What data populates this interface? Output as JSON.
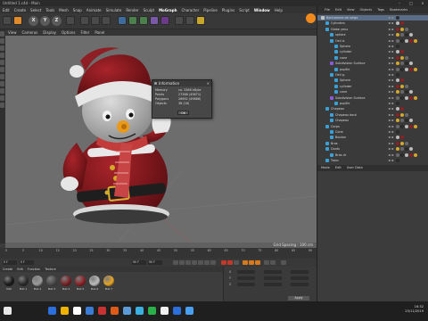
{
  "window": {
    "title": "Untitled 1.c4d - Main",
    "ctrl_min": "–",
    "ctrl_max": "□",
    "ctrl_close": "×"
  },
  "menu": [
    "Edit",
    "Create",
    "Select",
    "Tools",
    "Mesh",
    "Snap",
    "Animate",
    "Simulate",
    "Render",
    "Sculpt",
    "MoGraph",
    "Character",
    "Pipeline",
    "Plugins",
    "Script",
    "Window",
    "Help"
  ],
  "toolbar": {
    "axis_labels": [
      "X",
      "Y",
      "Z"
    ]
  },
  "viewport": {
    "menu": [
      "View",
      "Cameras",
      "Display",
      "Options",
      "Filter",
      "Panel"
    ],
    "grid_spacing": "Grid Spacing : 100 cm"
  },
  "info_dialog": {
    "title": "Information",
    "rows": [
      {
        "label": "Memory",
        "value": "ca. 3366 kByte"
      },
      {
        "label": "Points",
        "value": "27568 (49871)"
      },
      {
        "label": "Polygons",
        "value": "26692 (49886)"
      },
      {
        "label": "Objects",
        "value": "38 (16)"
      }
    ],
    "ok_label": "OK"
  },
  "timeline": {
    "ticks": [
      "0",
      "5",
      "10",
      "15",
      "20",
      "25",
      "30",
      "35",
      "40",
      "45",
      "50",
      "55",
      "60",
      "65",
      "70",
      "75",
      "80",
      "85",
      "90"
    ],
    "frame_start": "0 F",
    "frame_end": "90 F",
    "current": "0 F"
  },
  "material_tabs": [
    "Create",
    "Edit",
    "Function",
    "Texture"
  ],
  "materials": [
    {
      "name": "Mat",
      "color": "#1a1a1a"
    },
    {
      "name": "Mat.1",
      "color": "#2a2a2a"
    },
    {
      "name": "Mat.2",
      "color": "#9a9a9a"
    },
    {
      "name": "Mat.3",
      "color": "#4a4a4a"
    },
    {
      "name": "Mat.4",
      "color": "#7a1f22"
    },
    {
      "name": "Mat.5",
      "color": "#8e1f24"
    },
    {
      "name": "Mat.6",
      "color": "#bcbcbc"
    },
    {
      "name": "Mat.7",
      "color": "#e8a420"
    }
  ],
  "attributes": {
    "rows": [
      "X",
      "Y",
      "Z"
    ],
    "apply_label": "Apply"
  },
  "right_panel": {
    "tabs": [
      "File",
      "Edit",
      "View",
      "Objects",
      "Tags",
      "Bookmarks"
    ],
    "objects": [
      {
        "name": "Bonhomme de neige",
        "indent": 0,
        "color": "#c0c0c0",
        "selected": true
      },
      {
        "name": "Cylinders",
        "indent": 1,
        "color": "#3aa0d8",
        "selected": false
      },
      {
        "name": "Globe yeux",
        "indent": 1,
        "color": "#3aa0d8",
        "selected": false
      },
      {
        "name": "sphere",
        "indent": 2,
        "color": "#3aa0d8",
        "selected": false
      },
      {
        "name": "Oeil d.",
        "indent": 2,
        "color": "#3aa0d8",
        "selected": false
      },
      {
        "name": "Sphere",
        "indent": 3,
        "color": "#3aa0d8",
        "selected": false
      },
      {
        "name": "cylinder",
        "indent": 3,
        "color": "#3aa0d8",
        "selected": false
      },
      {
        "name": "cone",
        "indent": 3,
        "color": "#3aa0d8",
        "selected": false
      },
      {
        "name": "Subdivision Surface",
        "indent": 2,
        "color": "#8a5ad8",
        "selected": false
      },
      {
        "name": "pupille",
        "indent": 3,
        "color": "#3aa0d8",
        "selected": false
      },
      {
        "name": "Oeil g.",
        "indent": 2,
        "color": "#3aa0d8",
        "selected": false
      },
      {
        "name": "Sphere",
        "indent": 3,
        "color": "#3aa0d8",
        "selected": false
      },
      {
        "name": "cylinder",
        "indent": 3,
        "color": "#3aa0d8",
        "selected": false
      },
      {
        "name": "cone",
        "indent": 3,
        "color": "#3aa0d8",
        "selected": false
      },
      {
        "name": "Subdivision Surface",
        "indent": 2,
        "color": "#8a5ad8",
        "selected": false
      },
      {
        "name": "pupille",
        "indent": 3,
        "color": "#3aa0d8",
        "selected": false
      },
      {
        "name": "Chapeau",
        "indent": 1,
        "color": "#3aa0d8",
        "selected": false
      },
      {
        "name": "Chapeau bout",
        "indent": 2,
        "color": "#3aa0d8",
        "selected": false
      },
      {
        "name": "Chapeau",
        "indent": 2,
        "color": "#3aa0d8",
        "selected": false
      },
      {
        "name": "Corps",
        "indent": 1,
        "color": "#3aa0d8",
        "selected": false
      },
      {
        "name": "Cone",
        "indent": 2,
        "color": "#3aa0d8",
        "selected": false
      },
      {
        "name": "Bouton",
        "indent": 2,
        "color": "#3aa0d8",
        "selected": false
      },
      {
        "name": "Bras",
        "indent": 1,
        "color": "#3aa0d8",
        "selected": false
      },
      {
        "name": "Gants",
        "indent": 1,
        "color": "#3aa0d8",
        "selected": false
      },
      {
        "name": "Bras dr",
        "indent": 2,
        "color": "#3aa0d8",
        "selected": false
      },
      {
        "name": "Tronc",
        "indent": 1,
        "color": "#3aa0d8",
        "selected": false
      }
    ],
    "attr_tabs": [
      "Mode",
      "Edit",
      "User Data"
    ]
  },
  "taskbar": {
    "icons": [
      "#e8e8e8",
      "#2a6fdb",
      "#f0b400",
      "#ffffff",
      "#3a7bd5",
      "#c83232",
      "#e05a1a",
      "#5a9ad8",
      "#3ab0e0",
      "#2ab04a",
      "#f0f0f0",
      "#2a6fdb",
      "#4aa0f0"
    ],
    "time": "16:32",
    "date": "25/11/2019"
  }
}
